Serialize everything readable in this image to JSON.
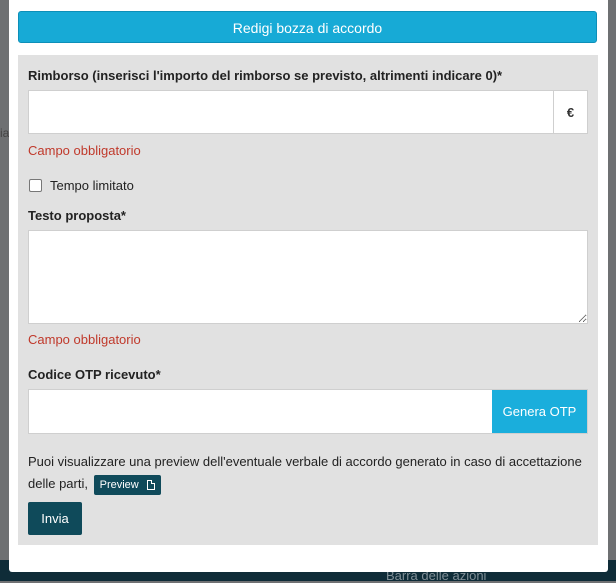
{
  "modal": {
    "title_button": "Redigi bozza di accordo"
  },
  "form": {
    "refund": {
      "label": "Rimborso (inserisci l'importo del rimborso se previsto, altrimenti indicare 0)*",
      "value": "",
      "currency_symbol": "€",
      "error": "Campo obbligatorio"
    },
    "limited_time": {
      "label": "Tempo limitato",
      "checked": false
    },
    "proposal_text": {
      "label": "Testo proposta*",
      "value": "",
      "error": "Campo obbligatorio"
    },
    "otp": {
      "label": "Codice OTP ricevuto*",
      "value": "",
      "generate_button": "Genera OTP"
    },
    "info_text": "Puoi visualizzare una preview dell'eventuale verbale di accordo generato in caso di accettazione delle parti,",
    "preview_button": "Preview",
    "submit_button": "Invia"
  },
  "background": {
    "footer_text": "Barra delle azioni",
    "left_stub": "ia"
  },
  "colors": {
    "primary": "#17aad6",
    "dark_button": "#0f4a5a",
    "error": "#c0392b",
    "panel": "#e1e1e1"
  }
}
